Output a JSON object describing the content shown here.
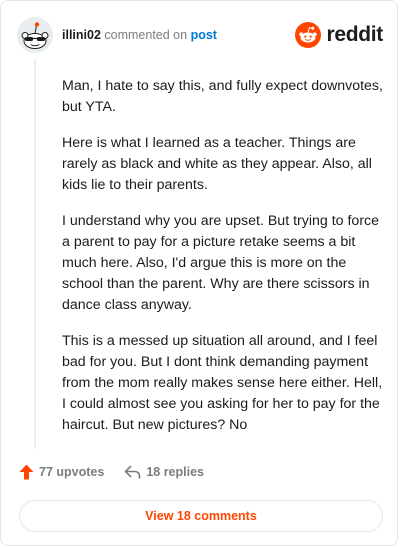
{
  "comment": {
    "author": "illini02",
    "action_text": "commented on",
    "target_link": "post",
    "paragraphs": [
      "Man, I hate to say this, and fully expect downvotes, but YTA.",
      "Here is what I learned as a teacher. Things are rarely as black and white as they appear. Also, all kids lie to their parents.",
      "I understand why you are upset. But trying to force a parent to pay for a picture retake seems a bit much here. Also, I'd argue this is more on the school than the parent. Why are there scissors in dance class anyway.",
      "This is a messed up situation all around, and I feel bad for you. But I dont think demanding payment from the mom really makes sense here either. Hell, I could almost see you asking for her to pay for the haircut. But new pictures? No"
    ]
  },
  "brand": {
    "name": "reddit",
    "icon": "reddit-snoo-icon",
    "color": "#ff4500"
  },
  "footer": {
    "upvotes_label": "77 upvotes",
    "replies_label": "18 replies",
    "upvote_icon": "upvote-arrow-icon",
    "reply_icon": "reply-arrow-icon"
  },
  "view_comments_label": "View 18 comments",
  "colors": {
    "accent": "#ff4500",
    "link": "#0079d3",
    "muted": "#7c7c7c"
  }
}
